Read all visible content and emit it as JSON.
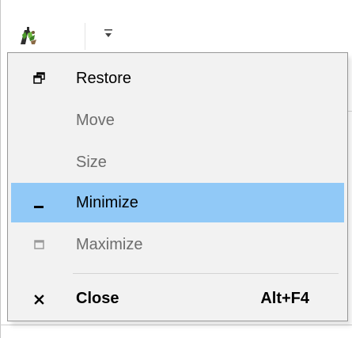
{
  "window": {
    "app_icon": "app-logo-icon",
    "qat_dropdown_icon": "chevron-down-icon"
  },
  "menu": {
    "items": [
      {
        "label": "Restore",
        "icon": "restore-icon",
        "enabled": true,
        "highlighted": false,
        "bold": false,
        "shortcut": ""
      },
      {
        "label": "Move",
        "icon": "",
        "enabled": false,
        "highlighted": false,
        "bold": false,
        "shortcut": ""
      },
      {
        "label": "Size",
        "icon": "",
        "enabled": false,
        "highlighted": false,
        "bold": false,
        "shortcut": ""
      },
      {
        "label": "Minimize",
        "icon": "minimize-icon",
        "enabled": true,
        "highlighted": true,
        "bold": false,
        "shortcut": ""
      },
      {
        "label": "Maximize",
        "icon": "maximize-icon",
        "enabled": false,
        "highlighted": false,
        "bold": false,
        "shortcut": ""
      },
      {
        "label": "Close",
        "icon": "close-icon",
        "enabled": true,
        "highlighted": false,
        "bold": true,
        "shortcut": "Alt+F4"
      }
    ]
  },
  "colors": {
    "highlight": "#91c9f7",
    "menu_background": "#f2f2f2",
    "menu_border": "#979797",
    "disabled_text": "#6d6d6d"
  }
}
